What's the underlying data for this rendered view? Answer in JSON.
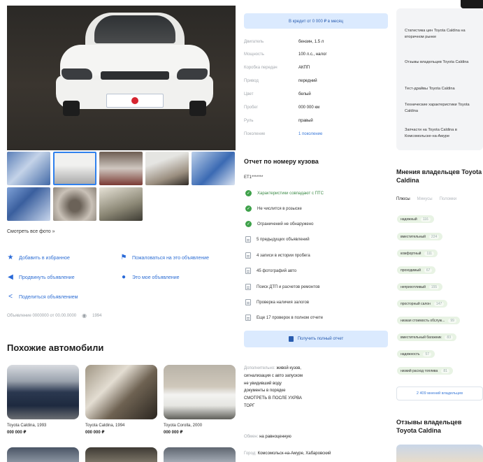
{
  "gallery": {
    "view_all": "Смотреть все фото »"
  },
  "actions": [
    {
      "label": "Добавить в избранное",
      "icon": "star-icon"
    },
    {
      "label": "Пожаловаться на это объявление",
      "icon": "flag-icon"
    },
    {
      "label": "Продвинуть объявление",
      "icon": "megaphone-icon"
    },
    {
      "label": "Это мое объявление",
      "icon": "user-icon"
    },
    {
      "label": "Поделиться объявлением",
      "icon": "share-icon"
    }
  ],
  "meta": {
    "listing_id": "Объявление 0000000 от 00.00.0000",
    "views": "1994"
  },
  "similar": {
    "title": "Похожие автомобили",
    "cards": [
      {
        "name": "Toyota Caldina, 1993",
        "price": "000 000 ₽"
      },
      {
        "name": "Toyota Caldina, 1994",
        "price": "000 000 ₽"
      },
      {
        "name": "Toyota Corolla, 2000",
        "price": "000 000 ₽"
      }
    ]
  },
  "credit_button": "В кредит от 0 000 ₽ в месяц",
  "specs": [
    {
      "key": "Двигатель",
      "value": "бензин, 1.5 л",
      "link": false
    },
    {
      "key": "Мощность",
      "value": "100 л.с., налог",
      "link": false
    },
    {
      "key": "Коробка передач",
      "value": "АКПП",
      "link": false
    },
    {
      "key": "Привод",
      "value": "передний",
      "link": false
    },
    {
      "key": "Цвет",
      "value": "белый",
      "link": false
    },
    {
      "key": "Пробег",
      "value": "000 000 км",
      "link": false
    },
    {
      "key": "Руль",
      "value": "правый",
      "link": false
    },
    {
      "key": "Поколение",
      "value": "1 поколение",
      "link": true
    }
  ],
  "report": {
    "title": "Отчет по номеру кузова",
    "vin": "ET1*******",
    "items": [
      {
        "text": "Характеристики совпадают с ПТС",
        "ok": true
      },
      {
        "text": "Не числится в розыске",
        "ok": true
      },
      {
        "text": "Ограничений не обнаружено",
        "ok": true
      },
      {
        "text": "5 предыдущих объявлений",
        "ok": false
      },
      {
        "text": "4 записи в истории пробега",
        "ok": false
      },
      {
        "text": "45 фотографий авто",
        "ok": false
      },
      {
        "text": "Поиск ДТП и расчетов ремонтов",
        "ok": false
      },
      {
        "text": "Проверка наличия залогов",
        "ok": false
      },
      {
        "text": "Еще 17 проверок в полном отчете",
        "ok": false
      }
    ],
    "button": "Получить полный отчет"
  },
  "extra": {
    "key": "Дополнительно:",
    "lines": [
      "живой кузов,",
      "сигнализация с авто запуском",
      "не увидивший воду",
      "документы в порядке",
      "СМОТРЕТЬ В ПОСЛЕ УХРВА",
      "ТОРГ"
    ]
  },
  "exchange": {
    "key": "Обмен:",
    "value": "на равноценную"
  },
  "city": {
    "key": "Город:",
    "value": "Комсомольск-на-Амуре, Хабаровский"
  },
  "links": [
    "Статистика цен Toyota Caldina на вторичном рынке",
    "Отзывы владельцев Toyota Caldina",
    "Тест-драйвы Toyota Caldina",
    "Технические характеристики Toyota Caldina",
    "Запчасти на Toyota Caldina в Комсомольске-на-Амуре"
  ],
  "opinions": {
    "title": "Мнения владельцев Toyota Caldina",
    "tabs": [
      "Плюсы",
      "Минусы",
      "Поломки"
    ],
    "tags": [
      {
        "label": "надежный",
        "count": "116"
      },
      {
        "label": "вместительный",
        "count": "224"
      },
      {
        "label": "комфортный",
        "count": "111"
      },
      {
        "label": "проходимый",
        "count": "67"
      },
      {
        "label": "неприхотливый",
        "count": "155"
      },
      {
        "label": "просторный салон",
        "count": "147"
      },
      {
        "label": "низкая стоимость обслуж...",
        "count": "99"
      },
      {
        "label": "вместительный багажник",
        "count": "83"
      },
      {
        "label": "надежность",
        "count": "57"
      },
      {
        "label": "низкий расход топлива",
        "count": "81"
      }
    ],
    "all_button": "2 409 мнений владельцев"
  },
  "reviews": {
    "title": "Отзывы владельцев Toyota Caldina"
  }
}
